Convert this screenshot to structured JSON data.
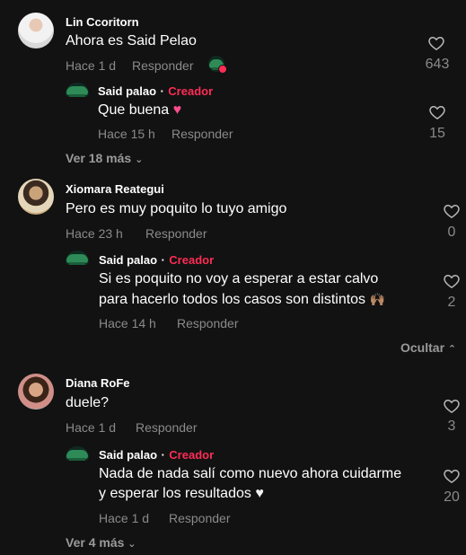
{
  "comments": [
    {
      "author": "Lin Ccoritorn",
      "text": "Ahora es Said Pelao",
      "time": "Hace 1 d",
      "reply_label": "Responder",
      "likes": "643",
      "replies": [
        {
          "author": "Said palao",
          "separator": "·",
          "badge": "Creador",
          "text": "Que buena",
          "emoji": "♥",
          "time": "Hace 15 h",
          "reply_label": "Responder",
          "likes": "15"
        }
      ],
      "view_more": "Ver 18 más"
    },
    {
      "author": "Xiomara Reategui",
      "text": "Pero es muy poquito lo tuyo amigo",
      "time": "Hace 23 h",
      "reply_label": "Responder",
      "likes": "0",
      "replies": [
        {
          "author": "Said palao",
          "separator": "·",
          "badge": "Creador",
          "text_line1": "Si es poquito no voy a esperar a estar calvo",
          "text_line2": "para hacerlo todos los casos son distintos",
          "emoji": "🙌🏽",
          "time": "Hace 14 h",
          "reply_label": "Responder",
          "likes": "2"
        }
      ],
      "hide_label": "Ocultar"
    },
    {
      "author": "Diana RoFe",
      "text": "duele?",
      "time": "Hace 1 d",
      "reply_label": "Responder",
      "likes": "3",
      "replies": [
        {
          "author": "Said palao",
          "separator": "·",
          "badge": "Creador",
          "text_line1": "Nada de nada salí como nuevo ahora cuidarme",
          "text_line2": "y esperar los resultados",
          "emoji": "♥",
          "time": "Hace 1 d",
          "reply_label": "Responder",
          "likes": "20"
        }
      ],
      "view_more": "Ver 4 más"
    }
  ],
  "colors": {
    "background": "#121212",
    "creator_badge": "#fe2c55",
    "muted": "#8a8a8a"
  }
}
